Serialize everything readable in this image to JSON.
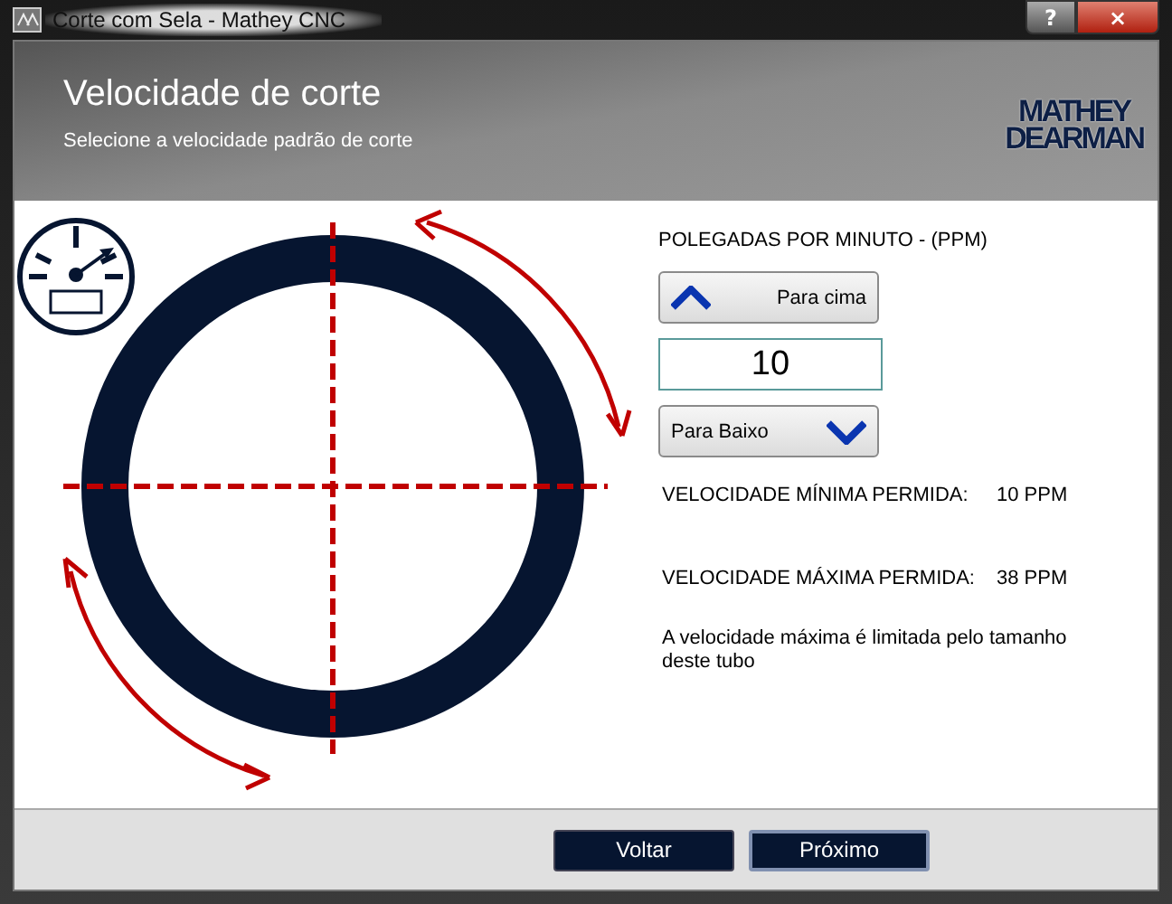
{
  "window": {
    "title": "Corte com Sela - Mathey CNC",
    "controls": [
      "?",
      "×"
    ]
  },
  "header": {
    "title": "Velocidade de corte",
    "subtitle": "Selecione a velocidade padrão de corte",
    "logo": [
      "MATHEY",
      "DEARMAN"
    ]
  },
  "speed": {
    "unit_label": "POLEGADAS POR MINUTO - (PPM)",
    "up_button": "Para cima",
    "value": "10",
    "down_button": "Para Baixo",
    "limits": [
      {
        "label": "VELOCIDADE MÍNIMA PERMIDA:",
        "value": "10 PPM"
      },
      {
        "label": "VELOCIDADE MÁXIMA PERMIDA:",
        "value": "38 PPM"
      }
    ],
    "note": "A velocidade máxima é limitada pelo tamanho deste tubo"
  },
  "footer": {
    "buttons": [
      {
        "label": "Voltar",
        "focused": false
      },
      {
        "label": "Próximo",
        "focused": true
      }
    ]
  }
}
